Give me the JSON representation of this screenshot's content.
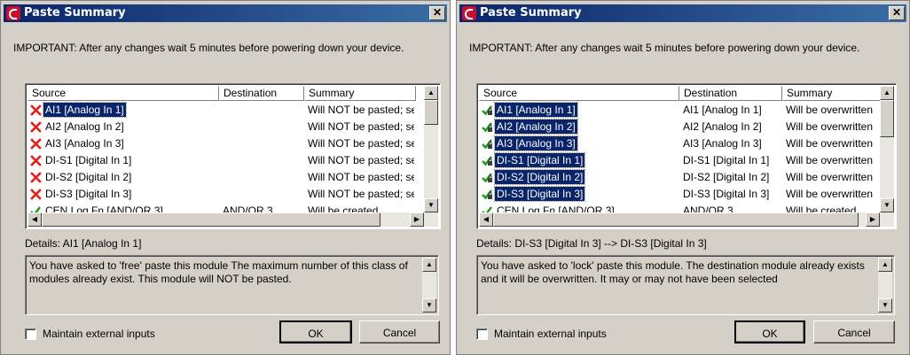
{
  "dialogs": [
    {
      "title": "Paste Summary",
      "important": "IMPORTANT: After any changes wait 5 minutes before powering down your device.",
      "columns": [
        "Source",
        "Destination",
        "Summary"
      ],
      "rows": [
        {
          "status": "x",
          "source": "AI1 [Analog In 1]",
          "destination": "",
          "summary": "Will NOT be pasted; se"
        },
        {
          "status": "x",
          "source": "AI2 [Analog In 2]",
          "destination": "",
          "summary": "Will NOT be pasted; se"
        },
        {
          "status": "x",
          "source": "AI3 [Analog In 3]",
          "destination": "",
          "summary": "Will NOT be pasted; se"
        },
        {
          "status": "x",
          "source": "DI-S1 [Digital In 1]",
          "destination": "",
          "summary": "Will NOT be pasted; se"
        },
        {
          "status": "x",
          "source": "DI-S2 [Digital In 2]",
          "destination": "",
          "summary": "Will NOT be pasted; se"
        },
        {
          "status": "x",
          "source": "DI-S3 [Digital In 3]",
          "destination": "",
          "summary": "Will NOT be pasted; se"
        },
        {
          "status": "check",
          "source": "CEN Log Fn [AND/OR 3]",
          "destination": "AND/OR 3",
          "summary": "Will be created"
        }
      ],
      "details_label": "Details: AI1 [Analog In 1]",
      "details_text": "You have asked to 'free' paste this module  The maximum number of this class of modules already exist.  This module will NOT be pasted.",
      "checkbox_label": "Maintain external inputs",
      "ok_label": "OK",
      "cancel_label": "Cancel"
    },
    {
      "title": "Paste Summary",
      "important": "IMPORTANT: After any changes wait 5 minutes before powering down your device.",
      "columns": [
        "Source",
        "Destination",
        "Summary"
      ],
      "rows": [
        {
          "status": "lock",
          "source": "AI1 [Analog In 1]",
          "destination": "AI1 [Analog In 1]",
          "summary": "Will be overwritten"
        },
        {
          "status": "lock",
          "source": "AI2 [Analog In 2]",
          "destination": "AI2 [Analog In 2]",
          "summary": "Will be overwritten"
        },
        {
          "status": "lock",
          "source": "AI3 [Analog In 3]",
          "destination": "AI3 [Analog In 3]",
          "summary": "Will be overwritten"
        },
        {
          "status": "lock",
          "source": "DI-S1 [Digital In 1]",
          "destination": "DI-S1 [Digital In 1]",
          "summary": "Will be overwritten"
        },
        {
          "status": "lock",
          "source": "DI-S2 [Digital In 2]",
          "destination": "DI-S2 [Digital In 2]",
          "summary": "Will be overwritten"
        },
        {
          "status": "lock",
          "source": "DI-S3 [Digital In 3]",
          "destination": "DI-S3 [Digital In 3]",
          "summary": "Will be overwritten"
        },
        {
          "status": "check",
          "source": "CEN Log Fn [AND/OR 3]",
          "destination": "AND/OR 3",
          "summary": "Will be created"
        }
      ],
      "details_label": "Details: DI-S3 [Digital In 3] --> DI-S3 [Digital In 3]",
      "details_text": "You have asked to 'lock' paste this module.  The destination module already exists and it will be overwritten.  It may or may not have been selected",
      "checkbox_label": "Maintain external inputs",
      "ok_label": "OK",
      "cancel_label": "Cancel"
    }
  ]
}
